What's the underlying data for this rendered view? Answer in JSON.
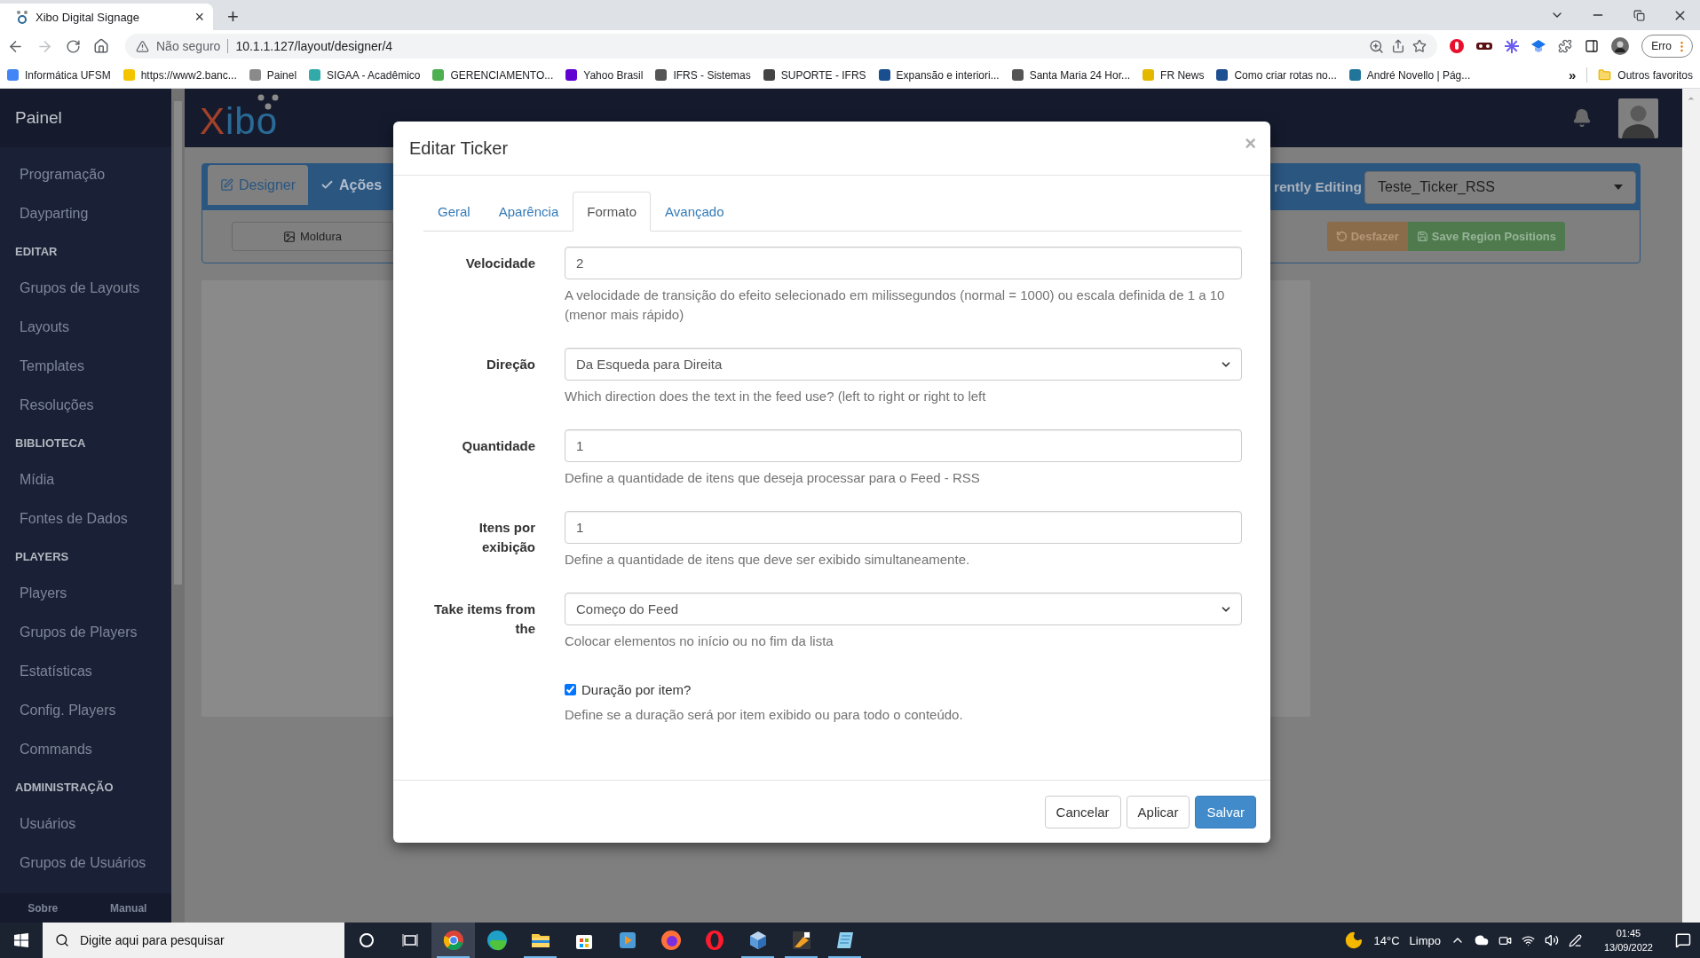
{
  "browser": {
    "tab": {
      "title": "Xibo Digital Signage",
      "close": "×"
    },
    "new_tab": "+",
    "security": "Não seguro",
    "url": "10.1.1.127/layout/designer/4",
    "profile_button": "Erro"
  },
  "bookmarks": [
    {
      "label": "Informática UFSM"
    },
    {
      "label": "https://www2.banc..."
    },
    {
      "label": "Painel"
    },
    {
      "label": "SIGAA - Acadêmico"
    },
    {
      "label": "GERENCIAMENTO..."
    },
    {
      "label": "Yahoo Brasil"
    },
    {
      "label": "IFRS - Sistemas"
    },
    {
      "label": "SUPORTE - IFRS"
    },
    {
      "label": "Expansão e interiori..."
    },
    {
      "label": "Santa Maria 24 Hor..."
    },
    {
      "label": "FR News"
    },
    {
      "label": "Como criar rotas no..."
    },
    {
      "label": "André Novello | Pág..."
    }
  ],
  "bookmarks_more": "»",
  "other_bookmarks": "Outros favoritos",
  "sidebar": {
    "title": "Painel",
    "items": [
      {
        "kind": "link",
        "label": "Programação"
      },
      {
        "kind": "link",
        "label": "Dayparting"
      },
      {
        "kind": "section",
        "label": "EDITAR"
      },
      {
        "kind": "link",
        "label": "Grupos de Layouts"
      },
      {
        "kind": "link",
        "label": "Layouts"
      },
      {
        "kind": "link",
        "label": "Templates"
      },
      {
        "kind": "link",
        "label": "Resoluções"
      },
      {
        "kind": "section",
        "label": "BIBLIOTECA"
      },
      {
        "kind": "link",
        "label": "Mídia"
      },
      {
        "kind": "link",
        "label": "Fontes de Dados"
      },
      {
        "kind": "section",
        "label": "PLAYERS"
      },
      {
        "kind": "link",
        "label": "Players"
      },
      {
        "kind": "link",
        "label": "Grupos de Players"
      },
      {
        "kind": "link",
        "label": "Estatísticas"
      },
      {
        "kind": "link",
        "label": "Config. Players"
      },
      {
        "kind": "link",
        "label": "Commands"
      },
      {
        "kind": "section",
        "label": "ADMINISTRAÇÃO"
      },
      {
        "kind": "link",
        "label": "Usuários"
      },
      {
        "kind": "link",
        "label": "Grupos de Usuários"
      }
    ],
    "footer": [
      "Sobre",
      "Manual"
    ]
  },
  "header": {
    "logo": "Xibo"
  },
  "designer": {
    "tabs": [
      {
        "label": "Designer",
        "selected": true
      },
      {
        "label": "Ações",
        "selected": false
      }
    ],
    "frame_button": "Moldura",
    "editing_label": "rently Editing",
    "layout_select": "Teste_Ticker_RSS",
    "undo_button": "Desfazer",
    "save_button": "Save Region Positions"
  },
  "modal": {
    "title": "Editar Ticker",
    "close": "×",
    "tabs": [
      {
        "label": "Geral",
        "selected": false
      },
      {
        "label": "Aparência",
        "selected": false
      },
      {
        "label": "Formato",
        "selected": true
      },
      {
        "label": "Avançado",
        "selected": false
      }
    ],
    "fields": [
      {
        "kind": "input",
        "label": "Velocidade",
        "value": "2",
        "help": "A velocidade de transição do efeito selecionado em milissegundos (normal = 1000) ou escala definida de 1 a 10 (menor mais rápido)"
      },
      {
        "kind": "select",
        "label": "Direção",
        "value": "Da Esqueda para Direita",
        "help": "Which direction does the text in the feed use? (left to right or right to left"
      },
      {
        "kind": "input",
        "label": "Quantidade",
        "value": "1",
        "help": "Define a quantidade de itens que deseja processar para o Feed - RSS"
      },
      {
        "kind": "input",
        "label": "Itens por exibição",
        "value": "1",
        "help": "Define a quantidade de itens que deve ser exibido simultaneamente."
      },
      {
        "kind": "select",
        "label": "Take items from the",
        "value": "Começo do Feed",
        "help": "Colocar elementos no início ou no fim da lista"
      },
      {
        "kind": "checkbox",
        "label": "Duração por item?",
        "checked": true,
        "help": "Define se a duração será por item exibido ou para todo o conteúdo."
      }
    ],
    "buttons": [
      {
        "kind": "default",
        "label": "Cancelar"
      },
      {
        "kind": "default",
        "label": "Aplicar"
      },
      {
        "kind": "primary",
        "label": "Salvar"
      }
    ]
  },
  "taskbar": {
    "search_placeholder": "Digite aqui para pesquisar",
    "apps": [
      {
        "kind": "chrome",
        "running": true,
        "selected": true
      },
      {
        "kind": "edge",
        "running": false,
        "selected": false
      },
      {
        "kind": "files",
        "running": true,
        "selected": false
      },
      {
        "kind": "store",
        "running": false,
        "selected": false
      },
      {
        "kind": "media",
        "running": false,
        "selected": false
      },
      {
        "kind": "firefox",
        "running": false,
        "selected": false
      },
      {
        "kind": "opera",
        "running": false,
        "selected": false
      },
      {
        "kind": "box",
        "running": true,
        "selected": false
      },
      {
        "kind": "paint",
        "running": true,
        "selected": false
      },
      {
        "kind": "notepad",
        "running": true,
        "selected": false
      }
    ],
    "weather": {
      "temperature": "14°C",
      "condition": "Limpo"
    },
    "time": "01:45",
    "date": "13/09/2022"
  }
}
